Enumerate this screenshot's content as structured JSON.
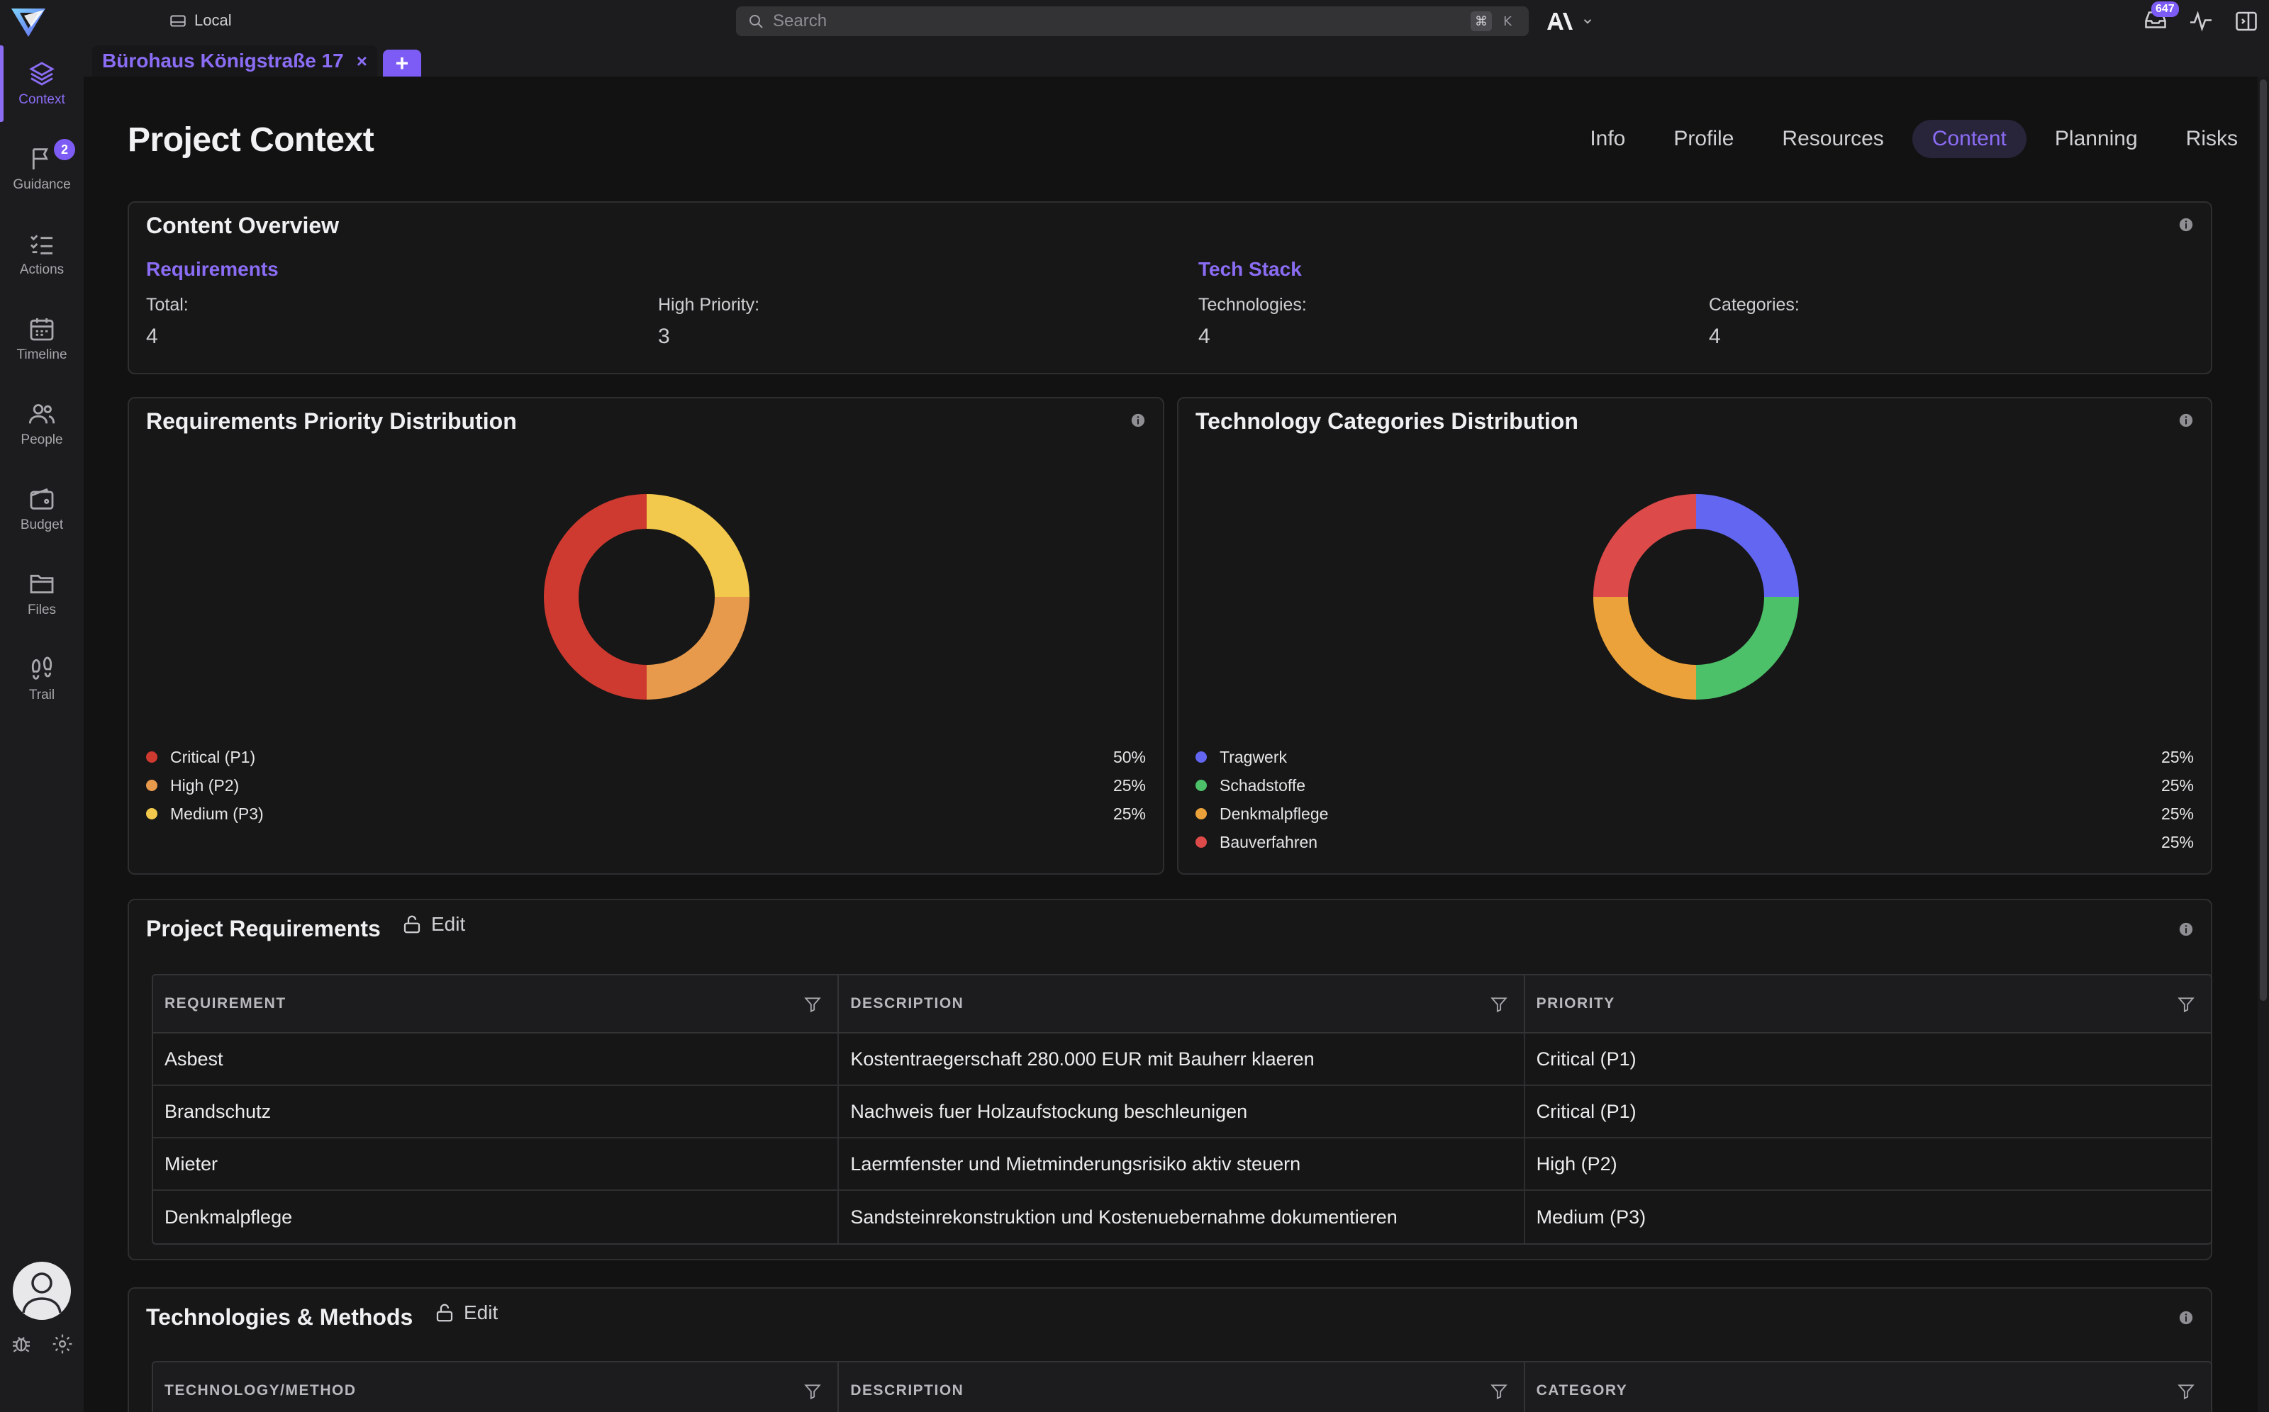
{
  "topbar": {
    "workspace_label": "Local",
    "search_placeholder": "Search",
    "shortcut_mod": "⌘",
    "shortcut_key": "K",
    "inbox_count": "647"
  },
  "sidebar": {
    "items": [
      {
        "label": "Context",
        "icon": "layers-icon"
      },
      {
        "label": "Guidance",
        "icon": "flag-icon",
        "badge": "2"
      },
      {
        "label": "Actions",
        "icon": "checklist-icon"
      },
      {
        "label": "Timeline",
        "icon": "calendar-icon"
      },
      {
        "label": "People",
        "icon": "users-icon"
      },
      {
        "label": "Budget",
        "icon": "wallet-icon"
      },
      {
        "label": "Files",
        "icon": "folder-icon"
      },
      {
        "label": "Trail",
        "icon": "footprints-icon"
      }
    ],
    "active": "Context"
  },
  "tabbar": {
    "project_tab": "Bürohaus Königstraße 17",
    "close_glyph": "×",
    "add_glyph": "+"
  },
  "page": {
    "title": "Project Context",
    "tabs": [
      "Info",
      "Profile",
      "Resources",
      "Content",
      "Planning",
      "Risks"
    ],
    "active_tab": "Content"
  },
  "overview": {
    "title": "Content Overview",
    "requirements": {
      "title": "Requirements",
      "total_label": "Total:",
      "total_value": "4",
      "high_label": "High Priority:",
      "high_value": "3"
    },
    "tech": {
      "title": "Tech Stack",
      "tech_label": "Technologies:",
      "tech_value": "4",
      "cat_label": "Categories:",
      "cat_value": "4"
    }
  },
  "chart_data": [
    {
      "type": "pie",
      "title": "Requirements Priority Distribution",
      "categories": [
        "Critical (P1)",
        "High (P2)",
        "Medium (P3)"
      ],
      "values": [
        50,
        25,
        25
      ],
      "labels": [
        "50%",
        "25%",
        "25%"
      ],
      "colors": [
        "#cf3a30",
        "#e89a4c",
        "#f2c94c"
      ],
      "legend": "bottom"
    },
    {
      "type": "pie",
      "title": "Technology Categories Distribution",
      "categories": [
        "Tragwerk",
        "Schadstoffe",
        "Denkmalpflege",
        "Bauverfahren"
      ],
      "values": [
        25,
        25,
        25,
        25
      ],
      "labels": [
        "25%",
        "25%",
        "25%",
        "25%"
      ],
      "colors": [
        "#6366f1",
        "#4cc16a",
        "#eba23a",
        "#dd4a4a"
      ],
      "legend": "bottom"
    }
  ],
  "requirements_table": {
    "title": "Project Requirements",
    "edit_label": "Edit",
    "columns": [
      "REQUIREMENT",
      "DESCRIPTION",
      "PRIORITY"
    ],
    "rows": [
      [
        "Asbest",
        "Kostentraegerschaft 280.000 EUR mit Bauherr klaeren",
        "Critical (P1)"
      ],
      [
        "Brandschutz",
        "Nachweis fuer Holzaufstockung beschleunigen",
        "Critical (P1)"
      ],
      [
        "Mieter",
        "Laermfenster und Mietminderungsrisiko aktiv steuern",
        "High (P2)"
      ],
      [
        "Denkmalpflege",
        "Sandsteinrekonstruktion und Kostenuebernahme dokumentieren",
        "Medium (P3)"
      ]
    ]
  },
  "tech_table": {
    "title": "Technologies & Methods",
    "edit_label": "Edit",
    "columns": [
      "TECHNOLOGY/METHOD",
      "DESCRIPTION",
      "CATEGORY"
    ]
  },
  "colors": {
    "accent": "#8b6df5",
    "badge": "#7c5cf4",
    "background": "#121212"
  }
}
